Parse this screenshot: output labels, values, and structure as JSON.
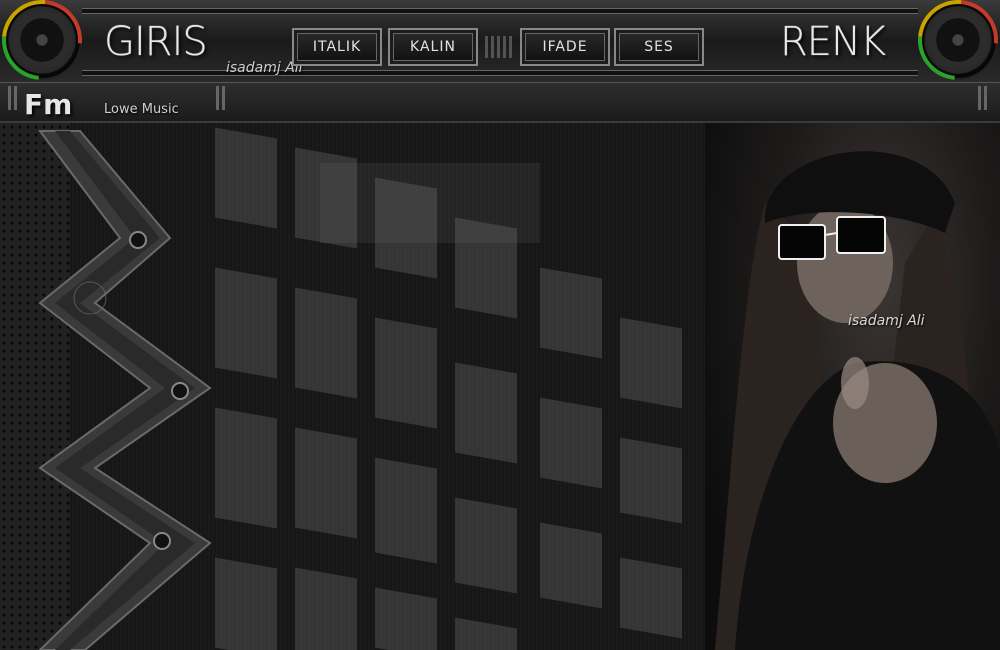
{
  "header": {
    "left_title": "GIRIS",
    "right_title": "RENK",
    "signature": "isadamj Ali",
    "nav": [
      {
        "label": "ITALIK"
      },
      {
        "label": "KALIN"
      },
      {
        "label": "IFADE"
      },
      {
        "label": "SES"
      }
    ]
  },
  "subbar": {
    "fm": "Fm",
    "station": "Lowe Music"
  },
  "main": {
    "photo_signature": "isadamj Ali"
  },
  "colors": {
    "background": "#151515",
    "accent_yellow": "#c9a400",
    "accent_green": "#29a329",
    "accent_red": "#c23b2b"
  }
}
